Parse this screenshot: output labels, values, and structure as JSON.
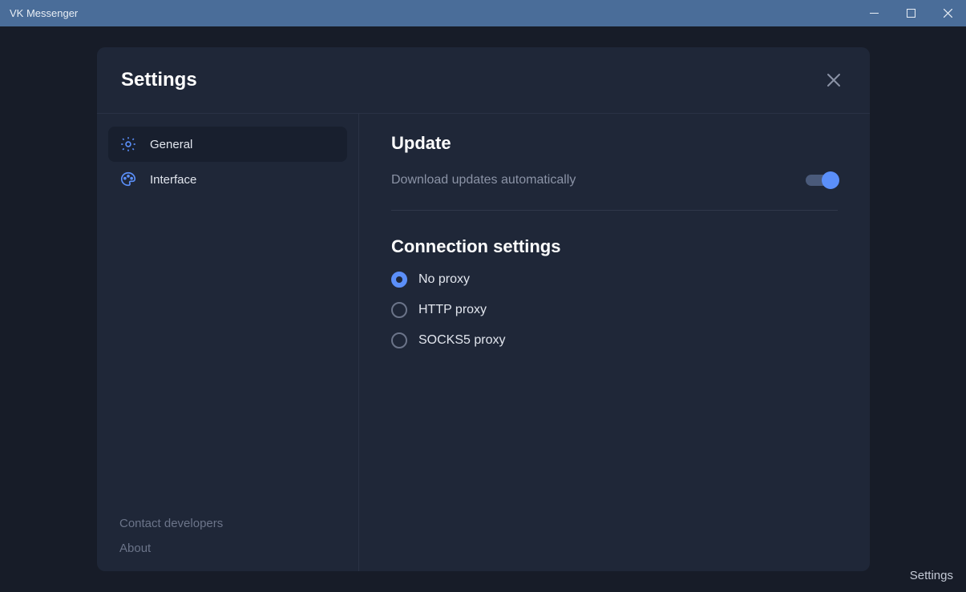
{
  "window": {
    "title": "VK Messenger"
  },
  "modal": {
    "title": "Settings"
  },
  "sidebar": {
    "items": [
      {
        "label": "General",
        "active": true
      },
      {
        "label": "Interface",
        "active": false
      }
    ],
    "footer": {
      "contact": "Contact developers",
      "about": "About"
    }
  },
  "content": {
    "update": {
      "title": "Update",
      "auto_label": "Download updates automatically",
      "auto_enabled": true
    },
    "connection": {
      "title": "Connection settings",
      "options": [
        {
          "label": "No proxy",
          "selected": true
        },
        {
          "label": "HTTP proxy",
          "selected": false
        },
        {
          "label": "SOCKS5 proxy",
          "selected": false
        }
      ]
    }
  },
  "status": {
    "label": "Settings"
  }
}
